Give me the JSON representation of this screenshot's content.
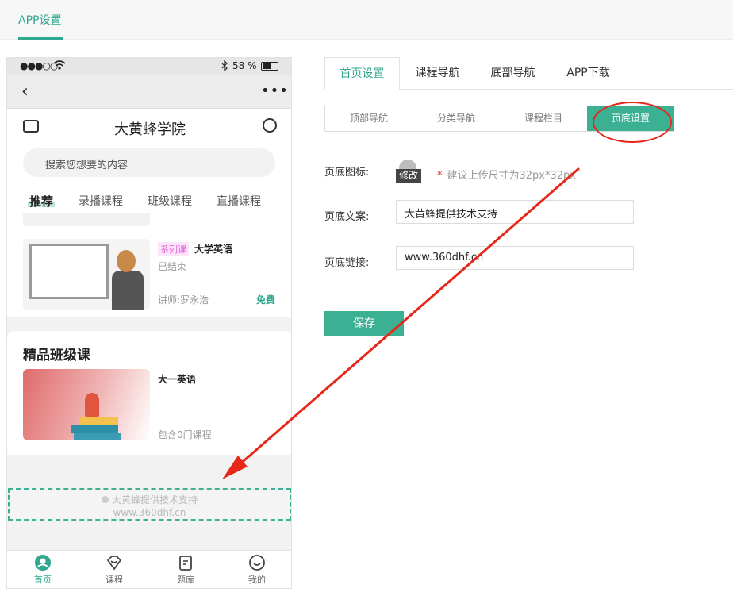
{
  "top_tab": {
    "label": "APP设置"
  },
  "phone": {
    "status_bar": {
      "signal": "●●●○○",
      "battery_pct": "58 %"
    },
    "nav": {
      "back": "‹",
      "more": "•••"
    },
    "header_title": "大黄蜂学院",
    "search_placeholder": "搜索您想要的内容",
    "categories": [
      "推荐",
      "录播课程",
      "班级课程",
      "直播课程"
    ],
    "course": {
      "tag": "系列课",
      "title": "大学英语",
      "status": "已结束",
      "teacher": "讲师:罗永浩",
      "price": "免费"
    },
    "section_title": "精品班级课",
    "class_course": {
      "title": "大一英语",
      "count": "包含0门课程"
    },
    "footer": {
      "text": "大黄蜂提供技术支持",
      "link": "www.360dhf.cn"
    },
    "tabbar": [
      {
        "label": "首页",
        "icon": "home-icon"
      },
      {
        "label": "课程",
        "icon": "course-icon"
      },
      {
        "label": "题库",
        "icon": "question-bank-icon"
      },
      {
        "label": "我的",
        "icon": "profile-icon"
      }
    ]
  },
  "settings": {
    "tabs": [
      "首页设置",
      "课程导航",
      "底部导航",
      "APP下载"
    ],
    "segments": [
      "顶部导航",
      "分类导航",
      "课程栏目",
      "页底设置"
    ],
    "icon_label": "页底图标:",
    "icon_upload_caption": "修改",
    "icon_hint_star": "*",
    "icon_hint": "建议上传尺寸为32px*32px",
    "text_label": "页底文案:",
    "text_value": "大黄蜂提供技术支持",
    "link_label": "页底链接:",
    "link_value": "www.360dhf.cn",
    "save_label": "保存"
  },
  "colors": {
    "accent": "#3bb093",
    "annotation": "#e8271b"
  }
}
